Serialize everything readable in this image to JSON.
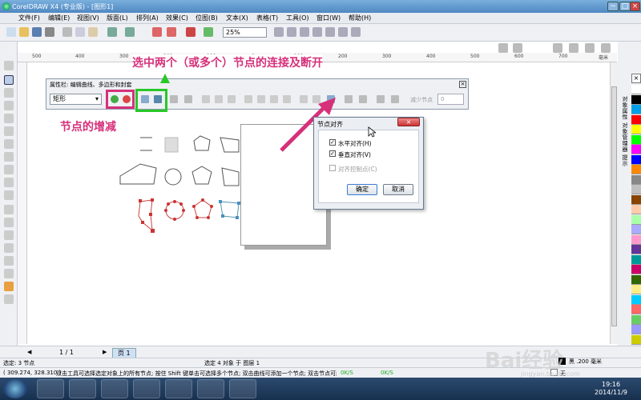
{
  "window": {
    "title": "CorelDRAW X4 (专业版) - [图形1]",
    "minimize_glyph": "−",
    "maximize_glyph": "□",
    "close_glyph": "×"
  },
  "menu": [
    "文件(F)",
    "编辑(E)",
    "视图(V)",
    "版面(L)",
    "排列(A)",
    "效果(C)",
    "位图(B)",
    "文本(X)",
    "表格(T)",
    "工具(O)",
    "窗口(W)",
    "帮助(H)"
  ],
  "toolbar": {
    "zoom": "25%"
  },
  "ruler": {
    "top_ticks": [
      "500",
      "400",
      "300",
      "200",
      "100",
      "0",
      "100",
      "200",
      "300",
      "400",
      "500",
      "600",
      "700"
    ],
    "unit": "毫米"
  },
  "property_bar": {
    "title": "属性栏: 编辑曲线、多边形和封套",
    "shape_select": "矩形",
    "reduce_nodes_label": "减少节点",
    "reduce_value": "0"
  },
  "annotations": {
    "top": "选中两个（或多个）节点的连接及断开",
    "left": "节点的增减"
  },
  "dialog": {
    "title": "节点对齐",
    "close_glyph": "×",
    "options": [
      {
        "label": "水平对齐(H)",
        "checked": true,
        "disabled": false
      },
      {
        "label": "垂直对齐(V)",
        "checked": true,
        "disabled": false
      },
      {
        "label": "对齐控制点(C)",
        "checked": false,
        "disabled": true
      }
    ],
    "ok": "确定",
    "cancel": "取消"
  },
  "docker_tabs": "对象属性 对象管理器 提示",
  "pages": {
    "counter": "1 / 1",
    "tab": "页 1"
  },
  "status": {
    "left": "选定: 3 节点",
    "center": "选定 4 对象 于 图层 1",
    "coords": "( 309.274, 328.310 )",
    "hint": "双击工具可选择选定对象上的所有节点; 按住 Shift 键单击可选择多个节点; 双击曲线可添加一个节点; 双击节点可删除节点",
    "net1": "0K/S",
    "net2": "0K/S",
    "fill_label": "无",
    "outline": "黑 .200 毫米"
  },
  "clock": {
    "time": "19:16",
    "date": "2014/11/9"
  },
  "watermark": {
    "main": "Bai经验",
    "sub": "jingyan.baidu.com"
  },
  "palette_colors": [
    "#ffffff",
    "#000000",
    "#00a0e9",
    "#ff0000",
    "#ffff00",
    "#00ff00",
    "#ff00ff",
    "#0000ff",
    "#ff8800",
    "#888888",
    "#c0c0c0",
    "#884400",
    "#ffccaa",
    "#aaffaa",
    "#aaaaff",
    "#ff99cc",
    "#663399",
    "#009999",
    "#cc0066",
    "#336600",
    "#ffee88",
    "#00ccff",
    "#ff6666",
    "#66cc66",
    "#9999ff",
    "#cccc00"
  ]
}
